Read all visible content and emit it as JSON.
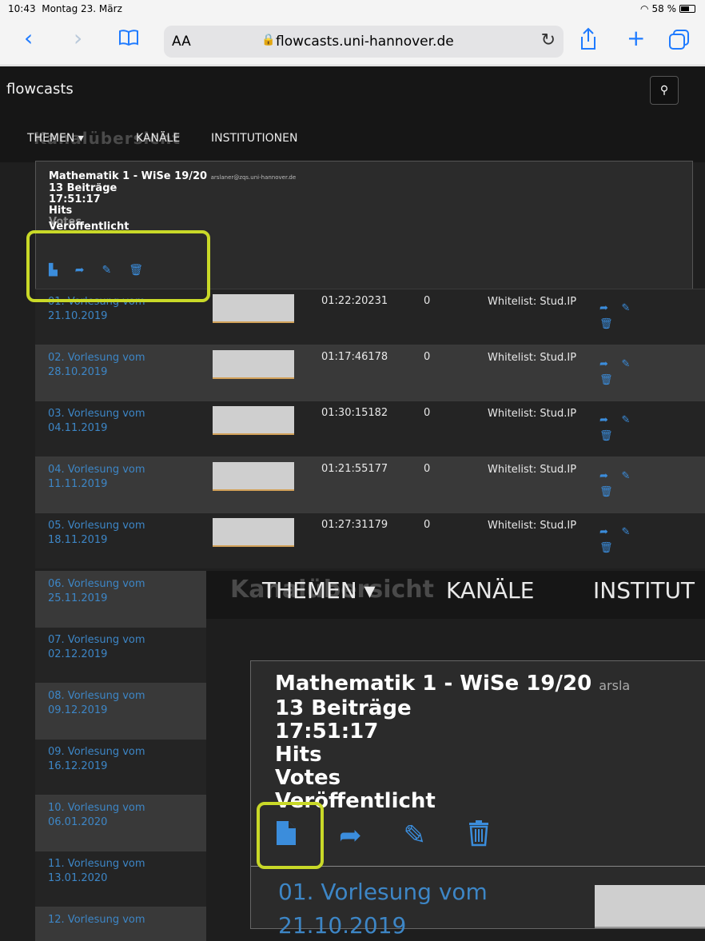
{
  "status": {
    "time": "10:43",
    "date": "Montag 23. März",
    "battery": "58 %"
  },
  "browser": {
    "text_size": "AA",
    "url": "flowcasts.uni-hannover.de"
  },
  "site": {
    "brand": "flowcasts"
  },
  "nav": {
    "themen": "THEMEN ▾",
    "kanaele": "KANÄLE",
    "institutionen": "INSTITUTIONEN",
    "ghost": "Kanalübersicht"
  },
  "channel": {
    "title": "Mathematik 1 - WiSe 19/20",
    "email": "arslaner@zqs.uni-hannover.de",
    "beitraege": "13 Beiträge",
    "duration": "17:51:17",
    "hits": "Hits",
    "votes": "Votes",
    "published": "Veröffentlicht"
  },
  "rows": [
    {
      "title": "01. Vorlesung vom 21.10.2019",
      "duration": "01:22:20",
      "hits": "231",
      "votes": "0",
      "access": "Whitelist: Stud.IP"
    },
    {
      "title": "02. Vorlesung vom 28.10.2019",
      "duration": "01:17:46",
      "hits": "178",
      "votes": "0",
      "access": "Whitelist: Stud.IP"
    },
    {
      "title": "03. Vorlesung vom 04.11.2019",
      "duration": "01:30:15",
      "hits": "182",
      "votes": "0",
      "access": "Whitelist: Stud.IP"
    },
    {
      "title": "04. Vorlesung vom 11.11.2019",
      "duration": "01:21:55",
      "hits": "177",
      "votes": "0",
      "access": "Whitelist: Stud.IP"
    },
    {
      "title": "05. Vorlesung vom 18.11.2019",
      "duration": "01:27:31",
      "hits": "179",
      "votes": "0",
      "access": "Whitelist: Stud.IP"
    }
  ],
  "more_rows": [
    "06. Vorlesung vom 25.11.2019",
    "07. Vorlesung vom 02.12.2019",
    "08. Vorlesung vom 09.12.2019",
    "09. Vorlesung vom 16.12.2019",
    "10. Vorlesung vom 06.01.2020",
    "11. Vorlesung vom 13.01.2020",
    "12. Vorlesung vom"
  ],
  "zoom": {
    "nav_themen": "THEMEN ▾",
    "nav_kanaele": "KANÄLE",
    "nav_inst": "INSTITUT",
    "ghost": "Kanalübersicht",
    "email": "arsla",
    "row_title": "01. Vorlesung vom 21.10.2019"
  },
  "icons": {
    "file": "file-icon",
    "share": "share-icon",
    "edit": "pencil-icon",
    "delete": "trash-icon"
  },
  "colors": {
    "link": "#3d86c6",
    "highlight": "#c9d928",
    "background": "#1f1f1f"
  }
}
